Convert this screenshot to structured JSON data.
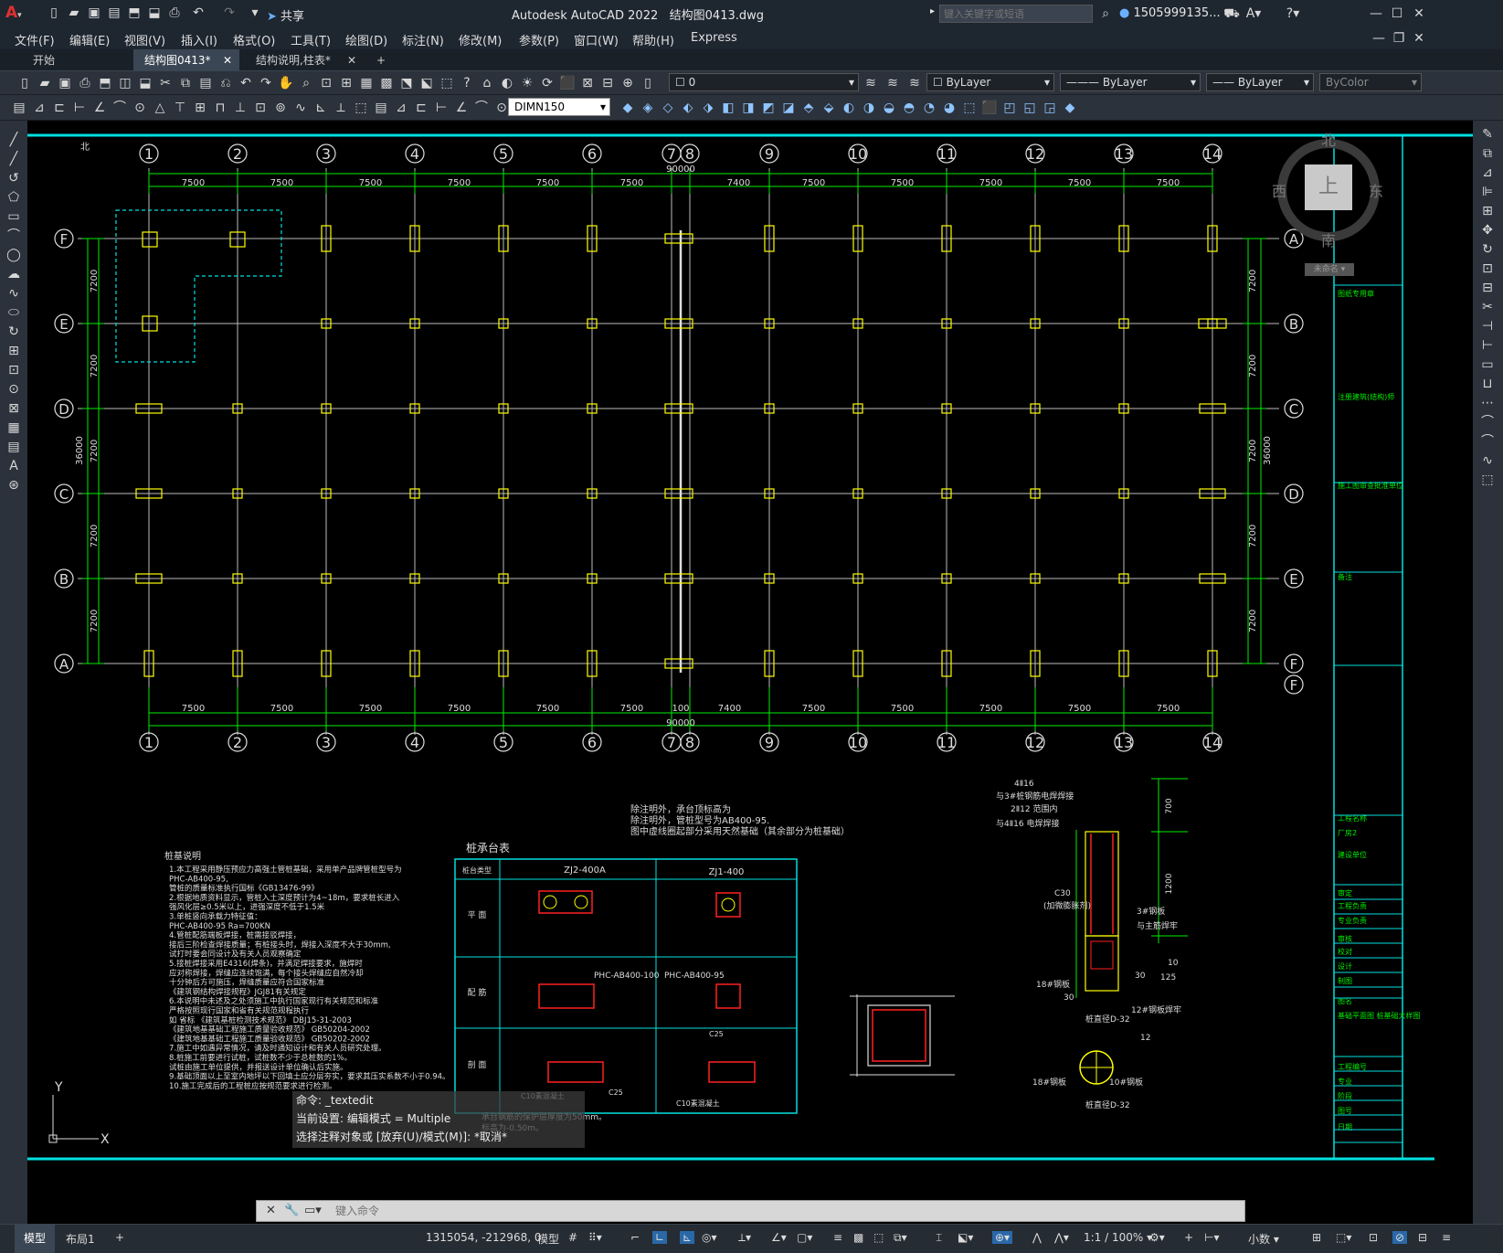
{
  "title_bar": {
    "app_title": "Autodesk AutoCAD 2022",
    "file_name": "结构图0413.dwg",
    "search_placeholder": "键入关键字或短语",
    "user": "1505999135...",
    "share": "共享"
  },
  "menu": [
    "文件(F)",
    "编辑(E)",
    "视图(V)",
    "插入(I)",
    "格式(O)",
    "工具(T)",
    "绘图(D)",
    "标注(N)",
    "修改(M)",
    "参数(P)",
    "窗口(W)",
    "帮助(H)",
    "Express"
  ],
  "tabs": [
    {
      "label": "开始"
    },
    {
      "label": "结构图0413*"
    },
    {
      "label": "结构说明,柱表*"
    }
  ],
  "toolbar": {
    "layer_value": "0",
    "color_value": "ByLayer",
    "linetype_value": "ByLayer",
    "lineweight_value": "ByLayer",
    "plotstyle_value": "ByColor",
    "dimstyle_value": "DIMN150"
  },
  "viewcube": {
    "north": "北",
    "south": "南",
    "east": "东",
    "west": "西",
    "top": "上",
    "wcs": "未命名"
  },
  "drawing": {
    "axis_numbers": [
      "1",
      "2",
      "3",
      "4",
      "5",
      "6",
      "7",
      "8",
      "9",
      "10",
      "11",
      "12",
      "13",
      "14"
    ],
    "axis_letters_left": [
      "F",
      "E",
      "D",
      "C",
      "B",
      "A"
    ],
    "axis_letters_right": [
      "A",
      "B",
      "C",
      "D",
      "E",
      "F"
    ],
    "spacings_top": [
      "7500",
      "7500",
      "7500",
      "7500",
      "7500",
      "7500",
      "7400",
      "7500",
      "7500",
      "7500",
      "7500",
      "7500"
    ],
    "spacings_bottom": [
      "7500",
      "7500",
      "7500",
      "7500",
      "7500",
      "7500",
      "100",
      "7400",
      "7500",
      "7500",
      "7500",
      "7500",
      "7500"
    ],
    "total_width": "90000",
    "total_height": "36000",
    "row_spacing": "7200",
    "north_mark": "北",
    "note_lines": [
      "除注明外，承台顶标高为",
      "除注明外，管桩型号为AB400-95.",
      "图中虚线圈起部分采用天然基础（其余部分为桩基础）"
    ],
    "pile_table_title": "桩承台表",
    "pile_table": {
      "h_type": "桩台类型",
      "col1": "ZJ2-400A",
      "col2": "ZJ1-400",
      "rows": [
        "平 面",
        "配 筋",
        "剖 面"
      ],
      "pile1": "PHC-AB400-100",
      "pile2": "PHC-AB400-95",
      "c25": "C25",
      "c10": "C10素混凝土"
    },
    "notes_title": "桩基说明",
    "notes": [
      "1.本工程采用静压预应力高强土管桩基础，采用单产品牌管桩型号为",
      "   PHC-AB400-95,",
      "   管桩的质量标准执行国标《GB13476-99》",
      "2.根据地质资料显示，管桩入土深度预计为4~18m，要求桩长进入",
      "   强风化层≥0.5米以上，进强深度不低于1.5米",
      "3.单桩竖向承载力特征值：",
      "   PHC-AB400-95 Ra=700KN",
      "4.管桩配筋端板焊接，桩需接驳焊接，",
      "   接后三阶检查焊接质量；有桩接头时，焊接入深度不大于30mm,",
      "   试打时要会同设计及有关人员观察确定",
      "5.接桩焊接采用E4316(焊条)，并满足焊接要求，施焊时",
      "   应对称焊接，焊缝应连续饱满，每个接头焊缝应自然冷却",
      "   十分钟后方可施压，焊缝质量应符合国家标准",
      "   《建筑钢结构焊接规程》JGJ81有关规定",
      "6.本说明中未述及之处须施工中执行国家现行有关规范和标准",
      "   严格按照现行国家和省有关规范规程执行",
      "   如 省标 《建筑基桩检测技术规范》 DBJ15-31-2003",
      "   《建筑地基基础工程施工质量验收规范》 GB50204-2002",
      "   《建筑地基基础工程施工质量验收规范》 GB50202-2002",
      "7.施工中如遇异常情况，请及时通知设计和有关人员研究处理。",
      "8.桩施工前要进行试桩，试桩数不少于总桩数的1%。",
      "   试桩由施工单位提供，并报送设计单位确认后实施。",
      "9.基础顶面以上至室内地坪以下回填土应分层夯实，要求其压实系数不小于0.94。",
      "10.施工完成后的工程桩应按规范要求进行检测。"
    ],
    "col_detail": {
      "n1": "4Ⅱ16",
      "n2": "与3#桩钢筋电焊焊接",
      "n3": "2Ⅱ12 范围内",
      "n4": "与4Ⅱ16 电焊焊接",
      "c30": "C30",
      "c30b": "(加微膨胀剂)",
      "r3": "3#钢板",
      "r3b": "与主筋焊牢",
      "r18": "18#钢板",
      "r12": "12#钢板焊牢",
      "d1": "桩直径D-32",
      "d2": "桩直径D-32",
      "v700": "700",
      "v1200": "1200",
      "v30a": "30",
      "v30b": "30",
      "v125": "125",
      "v10": "10",
      "c12": "12",
      "c18": "18#钢板",
      "c10": "10#钢板"
    },
    "titleblock": [
      "图纸专用章",
      "注册建筑(结构)师",
      "施工图审查批准单位",
      "备注",
      "工程名称",
      "厂房2",
      "建设单位",
      "审定",
      "工程负责",
      "专业负责",
      "审核",
      "校对",
      "设计",
      "制图",
      "图名",
      "基础平面图 桩基础大样图",
      "工程编号",
      "专业",
      "阶段",
      "图号",
      "日期"
    ],
    "ucs_y": "Y",
    "ucs_x": "X"
  },
  "command": {
    "hist1": "命令: _textedit",
    "hist2": "当前设置: 编辑模式 = Multiple",
    "hist3": "选择注释对象或 [放弃(U)/模式(M)]: *取消*",
    "placeholder": "键入命令",
    "under1": "承台钢筋的保护层厚度为50mm。",
    "under2": "标高为-0.50m。"
  },
  "status": {
    "model_tab": "模型",
    "layout_tab": "布局1",
    "coords": "1315054, -212968, 0",
    "model": "模型",
    "scale": "1:1 / 100%",
    "units": "小数"
  }
}
